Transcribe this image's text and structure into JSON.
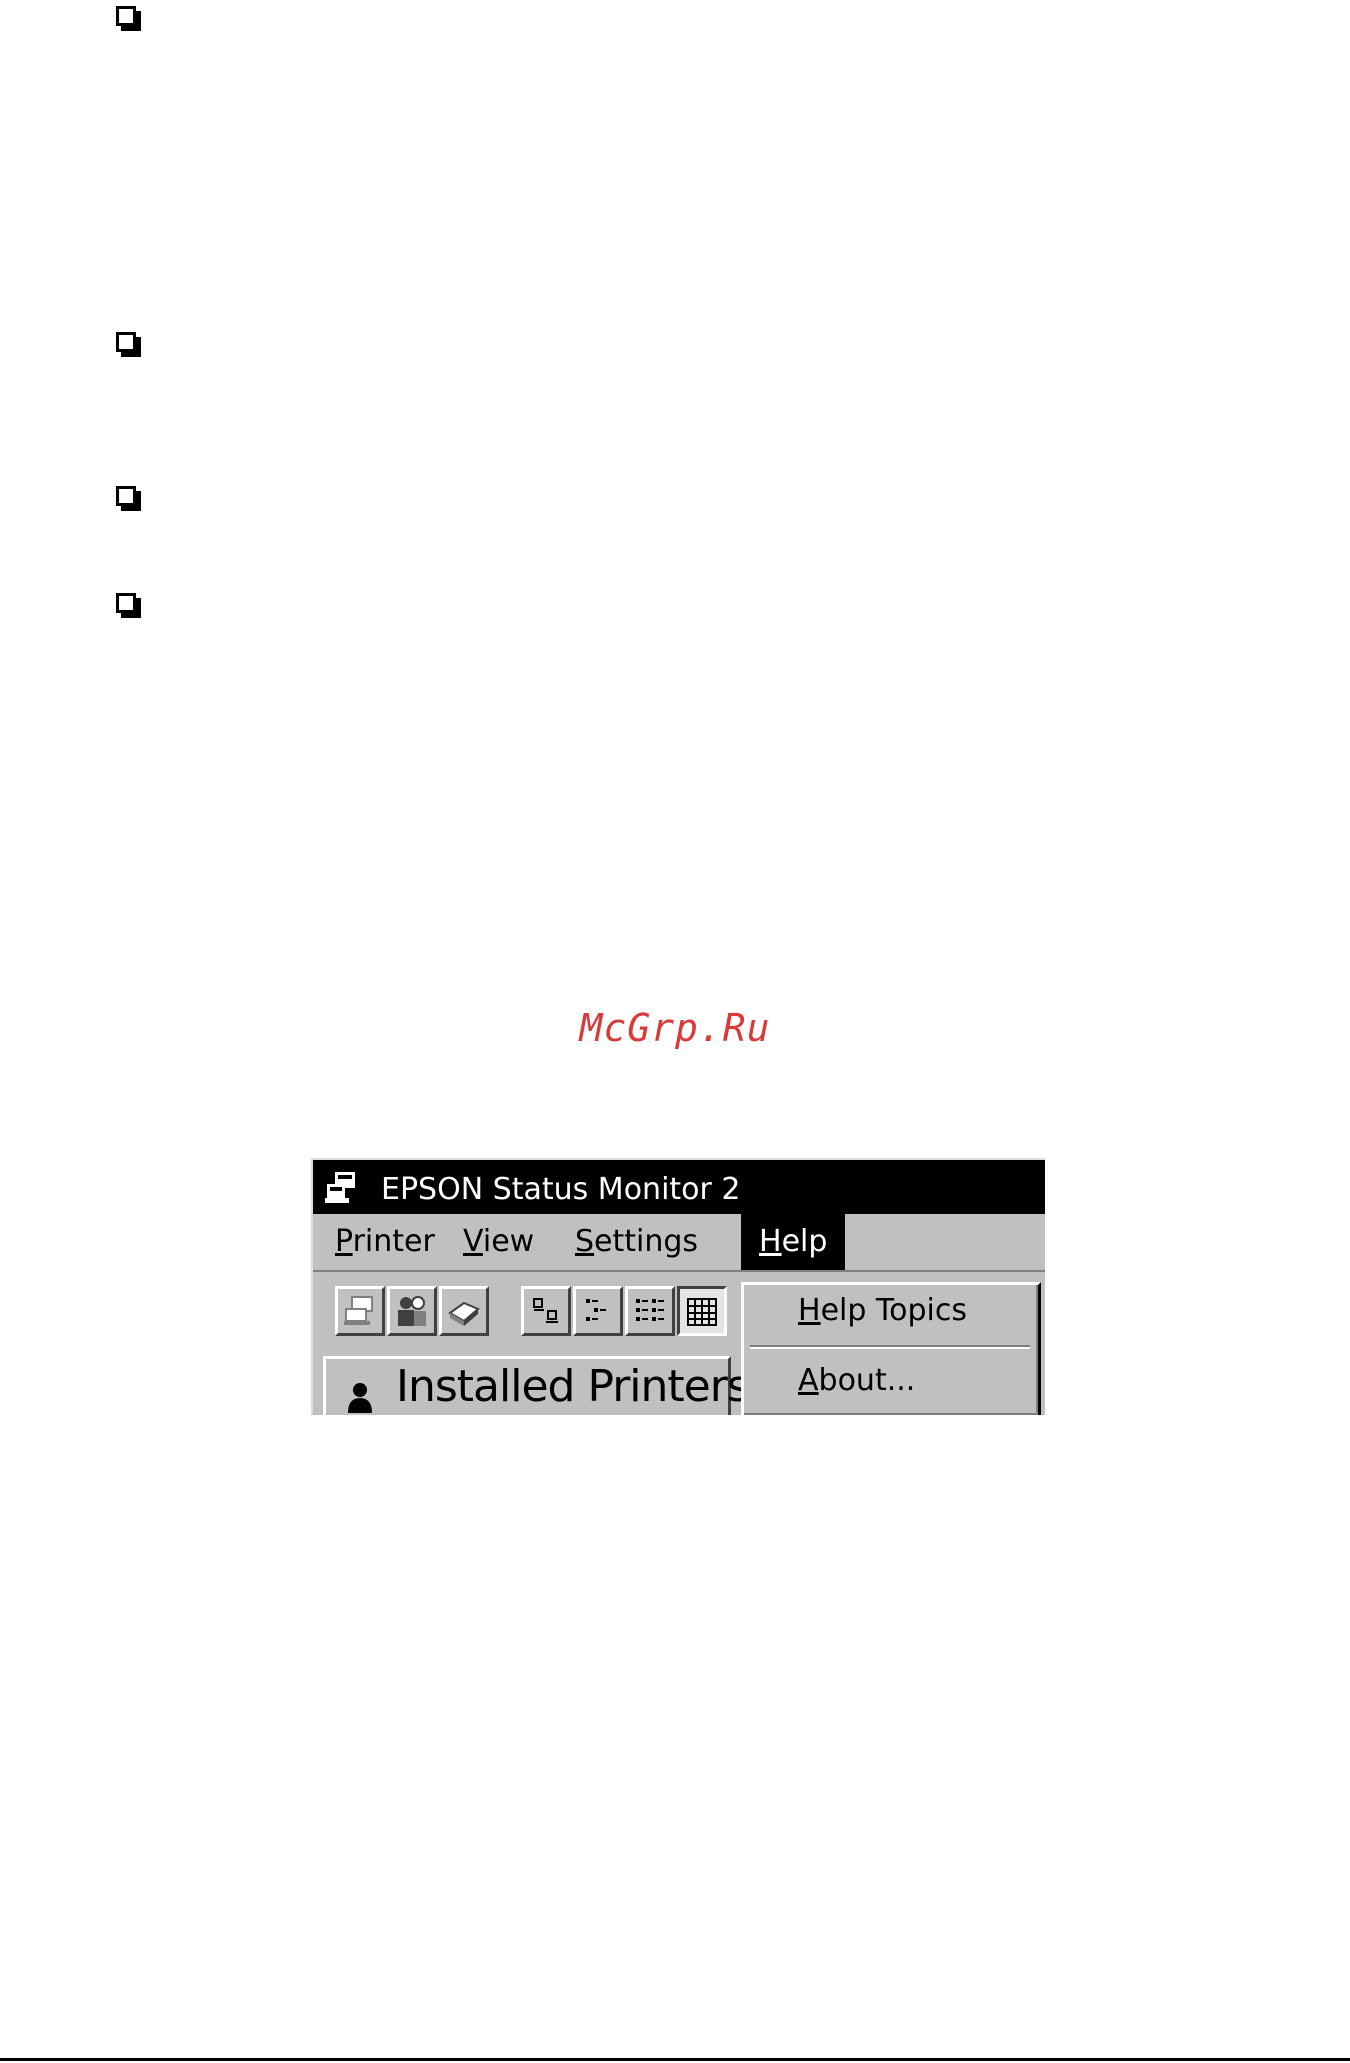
{
  "watermark": "McGrp.Ru",
  "window": {
    "title": "EPSON Status Monitor 2",
    "menu": [
      {
        "key": "P",
        "rest": "rinter"
      },
      {
        "key": "V",
        "rest": "iew"
      },
      {
        "key": "S",
        "rest": "ettings"
      },
      {
        "key": "H",
        "rest": "elp"
      }
    ],
    "help_menu": [
      {
        "key": "H",
        "rest": "elp Topics"
      },
      {
        "key": "A",
        "rest": "bout..."
      }
    ],
    "tab_label": "Installed Printers"
  }
}
